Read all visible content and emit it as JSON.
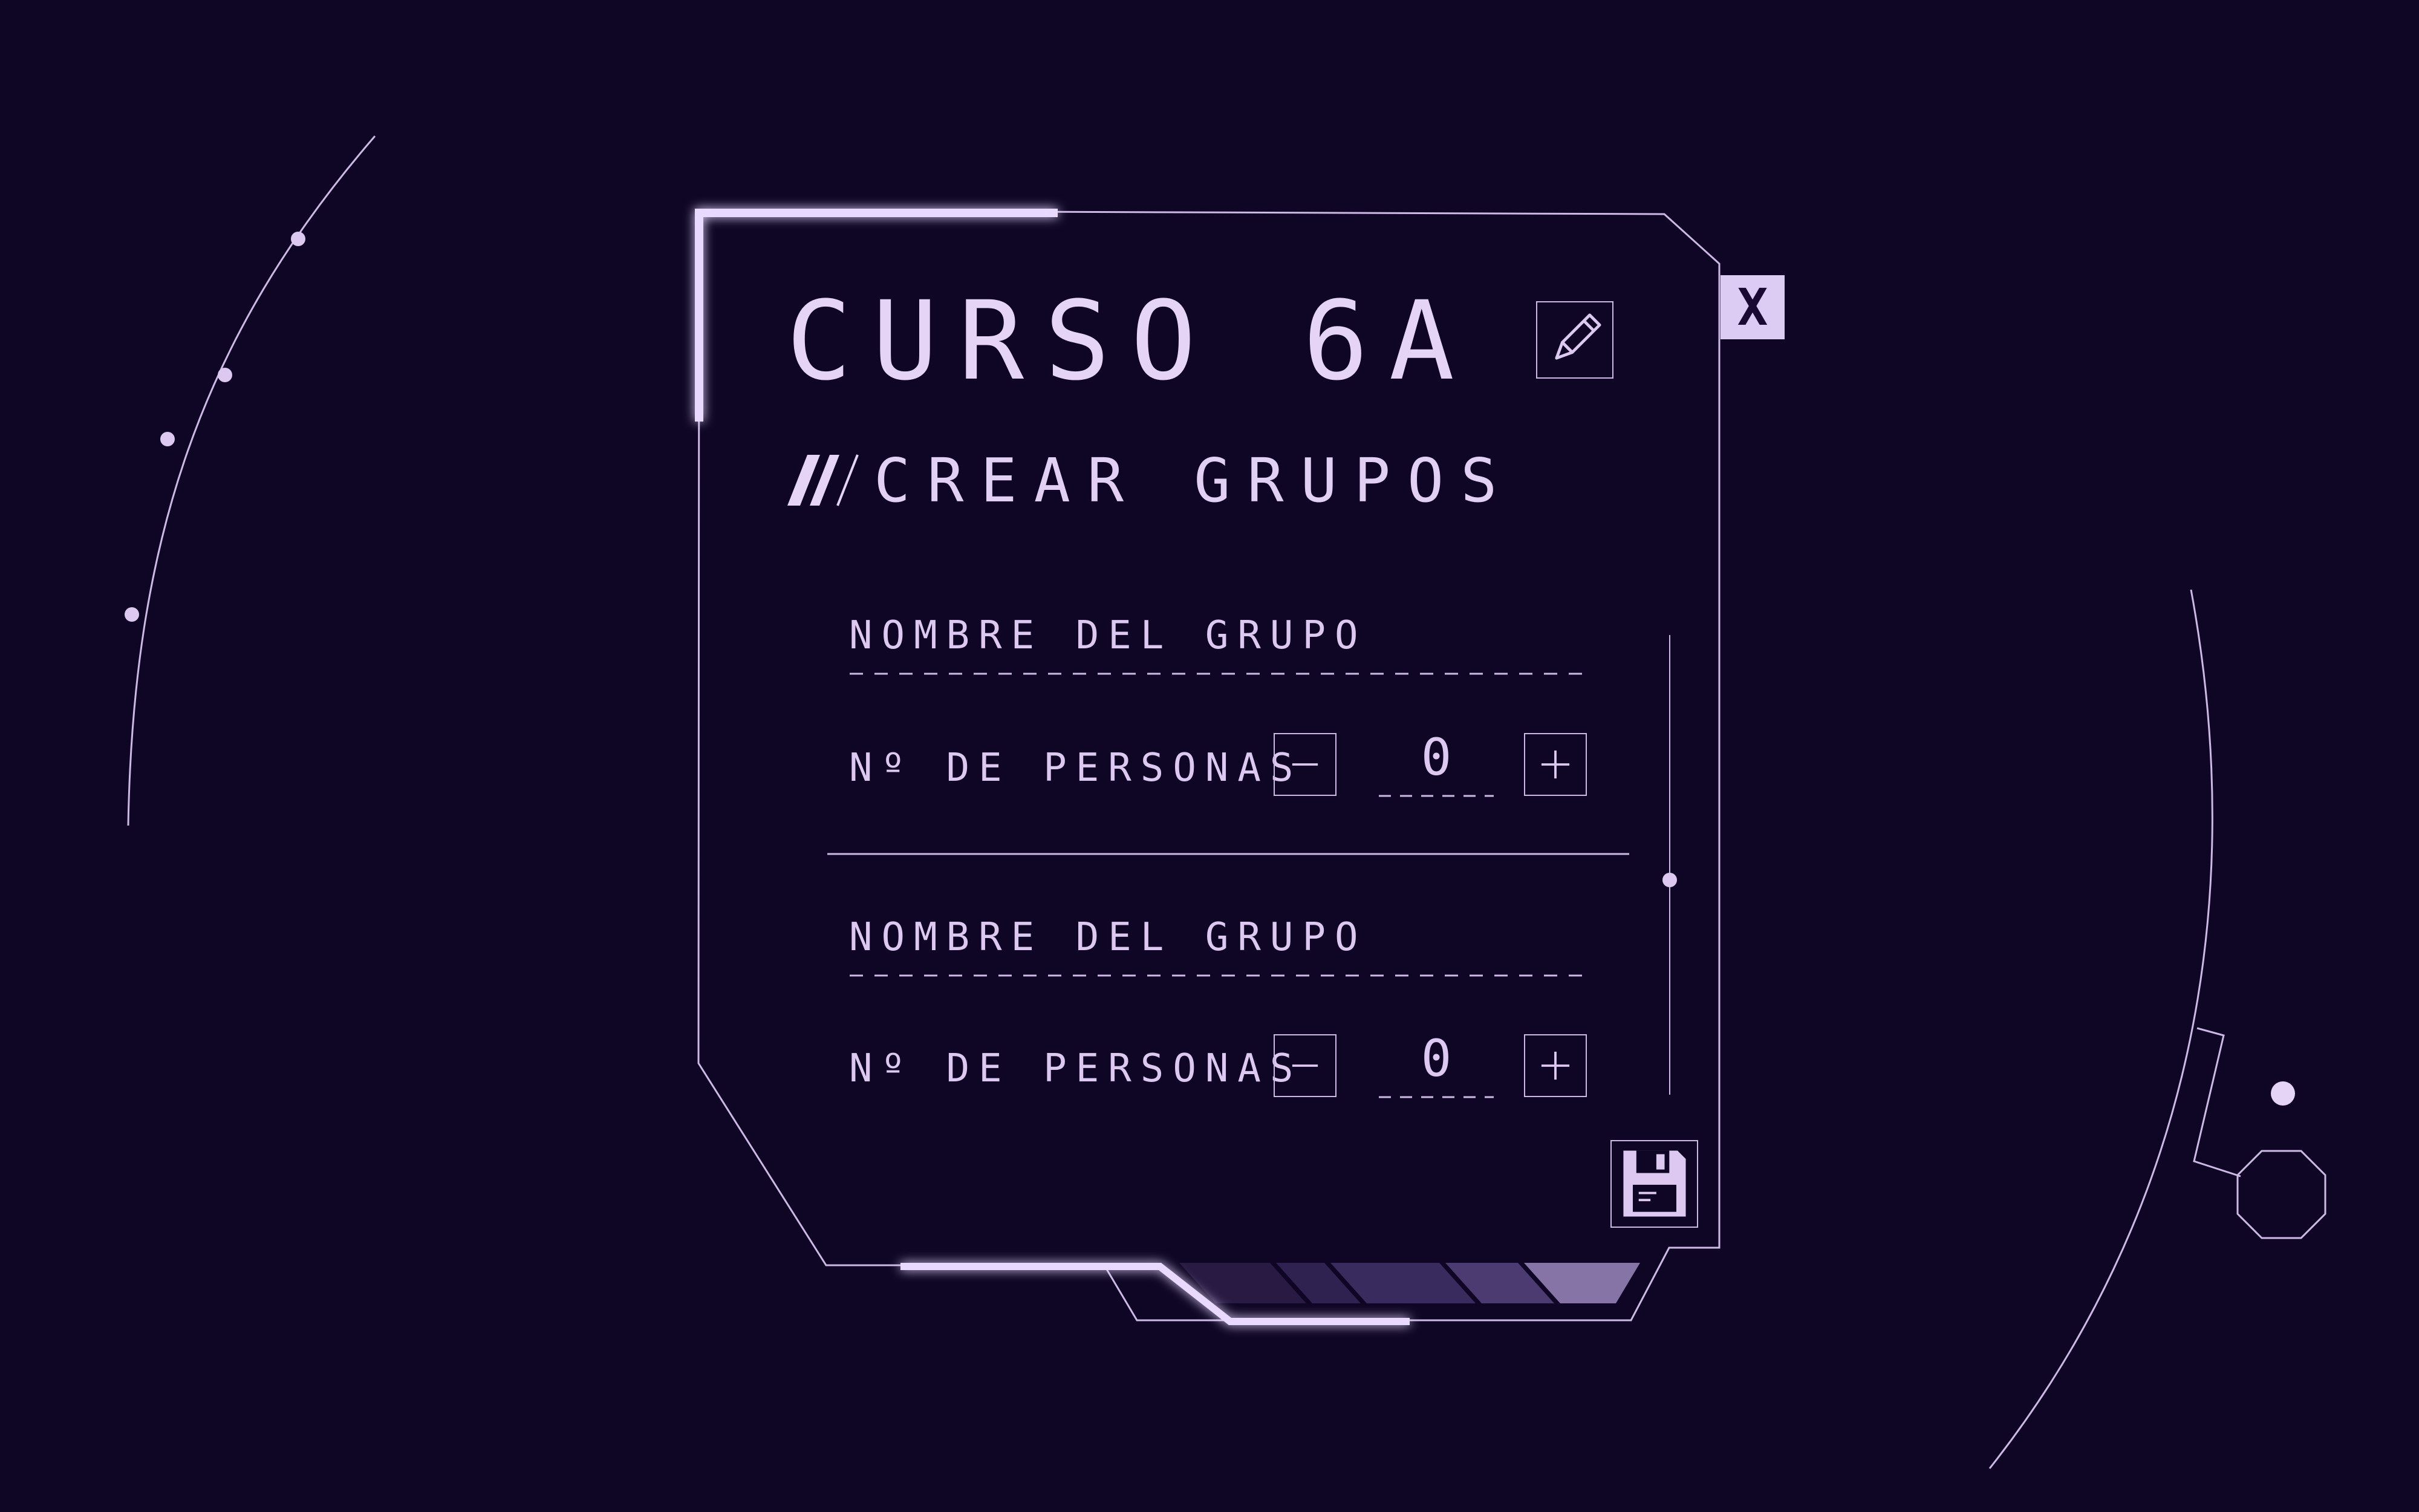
{
  "dialog": {
    "title": "CURSO 6A",
    "subtitle": "CREAR GRUPOS",
    "close_label": "X"
  },
  "groups": [
    {
      "name_label": "NOMBRE DEL GRUPO",
      "people_label": "Nº DE PERSONAS",
      "people_count": "0"
    },
    {
      "name_label": "NOMBRE DEL GRUPO",
      "people_label": "Nº DE PERSONAS",
      "people_count": "0"
    }
  ],
  "icons": {
    "edit": "pencil-icon",
    "close": "close-icon",
    "decrement": "minus-icon",
    "increment": "plus-icon",
    "save": "floppy-disk-icon"
  },
  "colors": {
    "background": "#0e0624",
    "accent": "#dcc8f0",
    "glow": "#c8a8ff",
    "close_button_bg": "#dccbf2"
  }
}
